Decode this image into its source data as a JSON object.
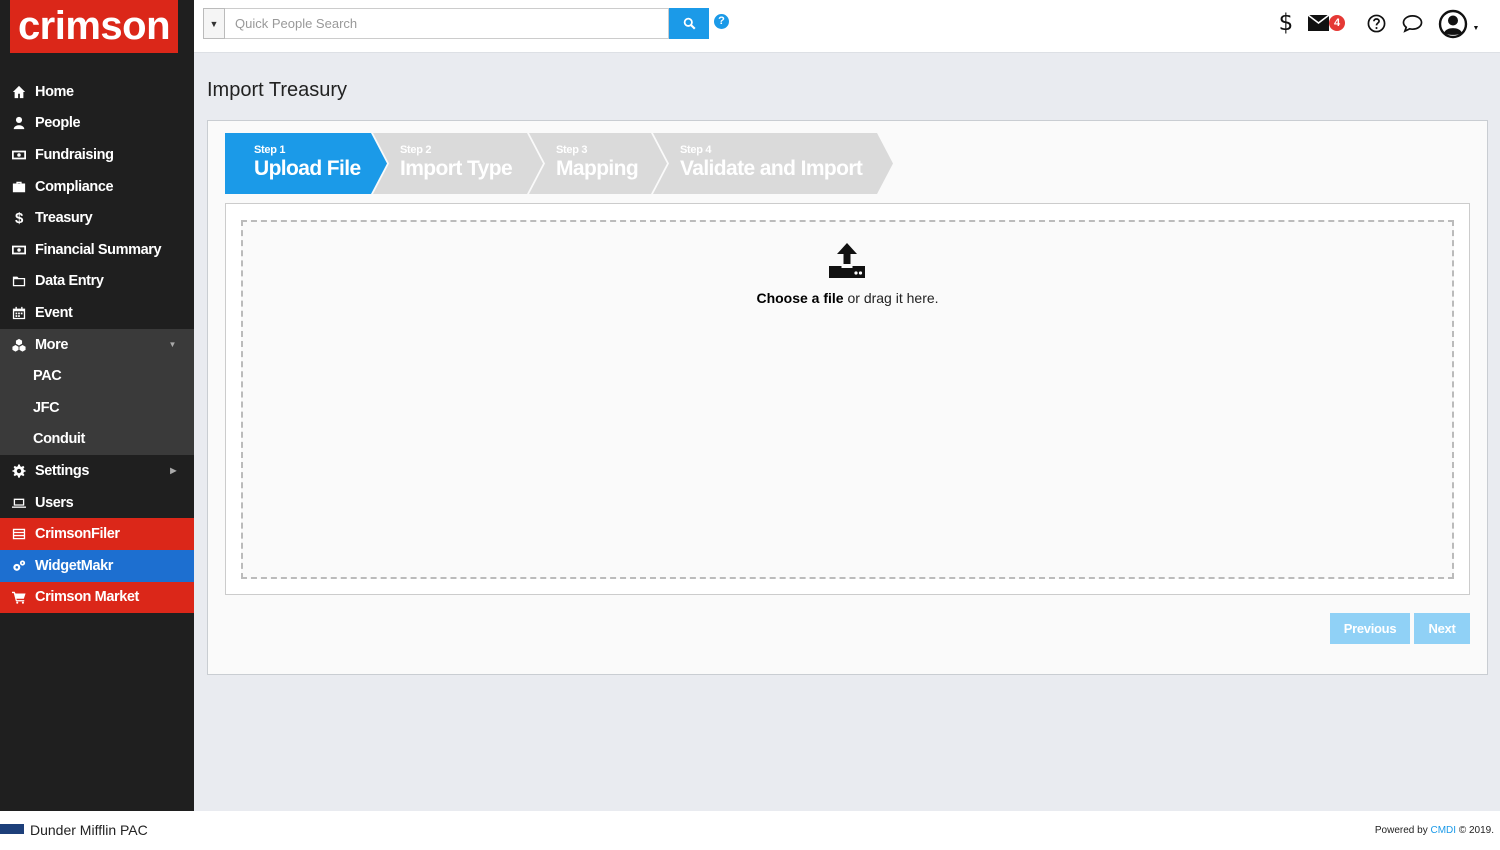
{
  "brand": {
    "logo_text": "crimson"
  },
  "sidebar": {
    "items": [
      {
        "label": "Home",
        "icon": "home-icon"
      },
      {
        "label": "People",
        "icon": "person-icon"
      },
      {
        "label": "Fundraising",
        "icon": "money-icon"
      },
      {
        "label": "Compliance",
        "icon": "briefcase-icon"
      },
      {
        "label": "Treasury",
        "icon": "dollar-icon"
      },
      {
        "label": "Financial Summary",
        "icon": "money-icon"
      },
      {
        "label": "Data Entry",
        "icon": "folder-icon"
      },
      {
        "label": "Event",
        "icon": "calendar-icon"
      }
    ],
    "more": {
      "label": "More",
      "icon": "cubes-icon",
      "sub": [
        "PAC",
        "JFC",
        "Conduit"
      ]
    },
    "settings": {
      "label": "Settings",
      "icon": "gear-icon"
    },
    "users": {
      "label": "Users",
      "icon": "laptop-icon"
    },
    "crimsonfiler": {
      "label": "CrimsonFiler",
      "icon": "list-icon",
      "color": "#db2719"
    },
    "widgetmakr": {
      "label": "WidgetMakr",
      "icon": "gears-icon",
      "color": "#1d6fd0"
    },
    "market": {
      "label": "Crimson Market",
      "icon": "cart-icon",
      "color": "#db2719"
    }
  },
  "topbar": {
    "search_placeholder": "Quick People Search",
    "mail_count": "4"
  },
  "page": {
    "title": "Import Treasury",
    "steps": [
      {
        "num": "Step 1",
        "name": "Upload File",
        "active": true
      },
      {
        "num": "Step 2",
        "name": "Import Type",
        "active": false
      },
      {
        "num": "Step 3",
        "name": "Mapping",
        "active": false
      },
      {
        "num": "Step 4",
        "name": "Validate and Import",
        "active": false
      }
    ],
    "dropzone": {
      "choose": "Choose a file",
      "rest": " or drag it here."
    },
    "buttons": {
      "previous": "Previous",
      "next": "Next"
    },
    "accent": "#1b9ae8"
  },
  "footer": {
    "org_name": "Dunder Mifflin PAC",
    "powered_prefix": "Powered by ",
    "powered_link": "CMDI",
    "powered_suffix": " © 2019."
  }
}
